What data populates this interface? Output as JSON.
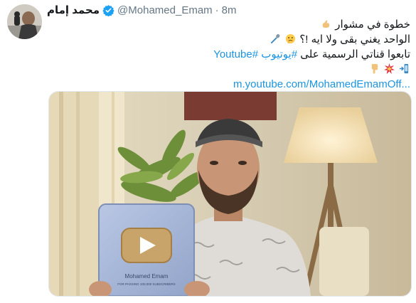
{
  "tweet": {
    "display_name": "محمد إمام",
    "handle": "@Mohamed_Emam",
    "separator": "·",
    "timestamp": "8m",
    "lines": [
      "خطوة في مشوار",
      "الواحد يغني بقى ولا ايه !؟",
      "تابعوا قناتي الرسمية على"
    ],
    "hashtags": [
      "#يوتيوب",
      "#Youtube"
    ],
    "link": "m.youtube.com/MohamedEmamOff...",
    "icons": [
      "verified-badge-icon",
      "muscle-emoji-icon",
      "thinking-face-emoji-icon",
      "microphone-emoji-icon",
      "phone-arrow-emoji-icon",
      "collision-emoji-icon",
      "pointing-down-emoji-icon"
    ]
  },
  "media": {
    "plaque_caption": "Mohamed Emam",
    "plaque_small_text": "FOR PASSING 100,000 SUBSCRIBERS",
    "colors": {
      "background": "#cfc4a8",
      "plaque": "#a7b6d6",
      "play_button": "#c8a36a",
      "shirt": "#dfdcd7"
    }
  }
}
